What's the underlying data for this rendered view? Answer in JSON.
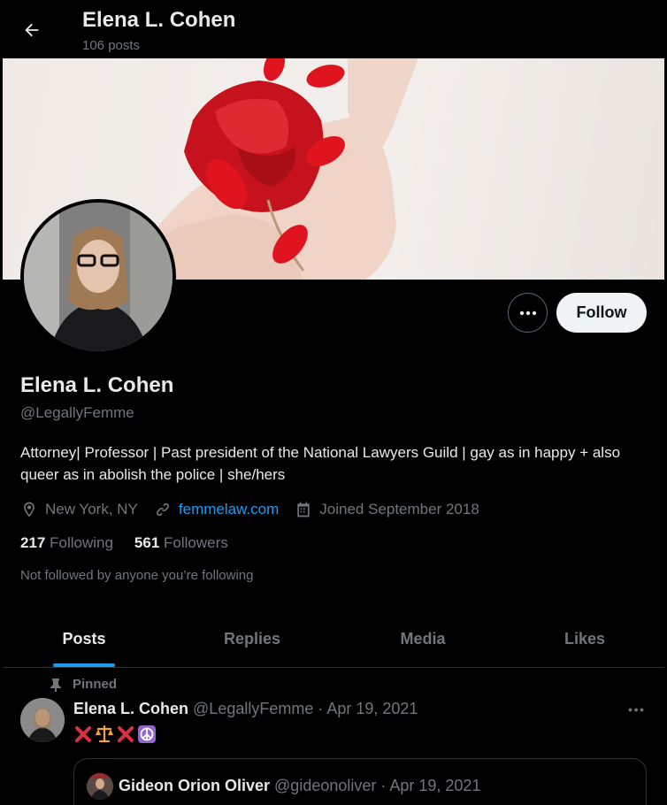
{
  "header": {
    "title": "Elena L. Cohen",
    "post_count": "106 posts"
  },
  "profile": {
    "name": "Elena L. Cohen",
    "handle": "@LegallyFemme",
    "bio": "Attorney| Professor | Past president of the National Lawyers Guild | gay as in happy + also queer as in abolish the police | she/hers",
    "location": "New York, NY",
    "website": "femmelaw.com",
    "joined": "Joined September 2018",
    "following_count": "217",
    "following_label": "Following",
    "followers_count": "561",
    "followers_label": "Followers",
    "not_followed_text": "Not followed by anyone you’re following",
    "follow_label": "Follow"
  },
  "tabs": [
    {
      "label": "Posts",
      "active": true
    },
    {
      "label": "Replies",
      "active": false
    },
    {
      "label": "Media",
      "active": false
    },
    {
      "label": "Likes",
      "active": false
    }
  ],
  "pinned_tweet": {
    "pinned_label": "Pinned",
    "name": "Elena L. Cohen",
    "handle_date": "@LegallyFemme · Apr 19, 2021",
    "emoji": [
      "cross-mark",
      "balance-scale",
      "cross-mark",
      "peace-symbol"
    ],
    "quote": {
      "name": "Gideon Orion Oliver",
      "handle_date": "@gideonoliver · Apr 19, 2021"
    }
  },
  "colors": {
    "background": "#000000",
    "text_primary": "#e7e9ea",
    "text_secondary": "#71767b",
    "accent": "#1d9bf0",
    "follow_button_bg": "#eff3f4",
    "border": "#2f3336",
    "nail_red": "#e0141e"
  }
}
